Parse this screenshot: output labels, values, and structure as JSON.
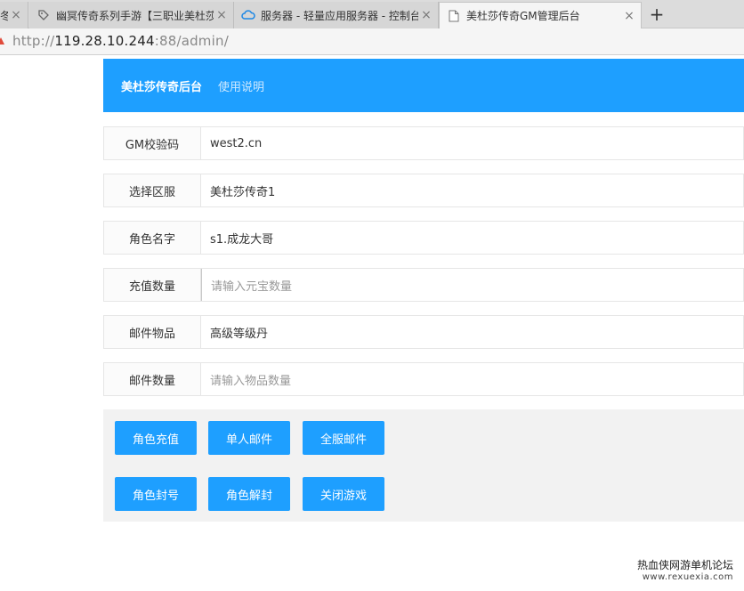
{
  "browser": {
    "tabs": [
      {
        "title": "冬",
        "icon": "page-icon",
        "active": false
      },
      {
        "title": "幽冥传奇系列手游【三职业美杜莎】",
        "icon": "tag-icon",
        "active": false
      },
      {
        "title": "服务器 - 轻量应用服务器 - 控制台",
        "icon": "cloud-icon",
        "active": false
      },
      {
        "title": "美杜莎传奇GM管理后台",
        "icon": "page-icon",
        "active": true
      }
    ],
    "new_tab_label": "+",
    "close_glyph": "×",
    "address": {
      "scheme": "http://",
      "host": "119.28.10.244",
      "rest": ":88/admin/"
    }
  },
  "header": {
    "brand": "美杜莎传奇后台",
    "nav_link": "使用说明"
  },
  "form": {
    "fields": [
      {
        "label": "GM校验码",
        "value": "west2.cn",
        "placeholder": ""
      },
      {
        "label": "选择区服",
        "value": "美杜莎传奇1",
        "placeholder": ""
      },
      {
        "label": "角色名字",
        "value": "s1.成龙大哥",
        "placeholder": ""
      },
      {
        "label": "充值数量",
        "value": "",
        "placeholder": "请输入元宝数量"
      },
      {
        "label": "邮件物品",
        "value": "高级等级丹",
        "placeholder": ""
      },
      {
        "label": "邮件数量",
        "value": "",
        "placeholder": "请输入物品数量"
      }
    ]
  },
  "buttons": {
    "recharge": "角色充值",
    "single_mail": "单人邮件",
    "all_mail": "全服邮件",
    "ban": "角色封号",
    "unban": "角色解封",
    "close_game": "关闭游戏"
  },
  "watermark": {
    "line1": "热血侠网游单机论坛",
    "line2": "www.rexuexia.com"
  },
  "colors": {
    "accent": "#1E9FFF"
  }
}
